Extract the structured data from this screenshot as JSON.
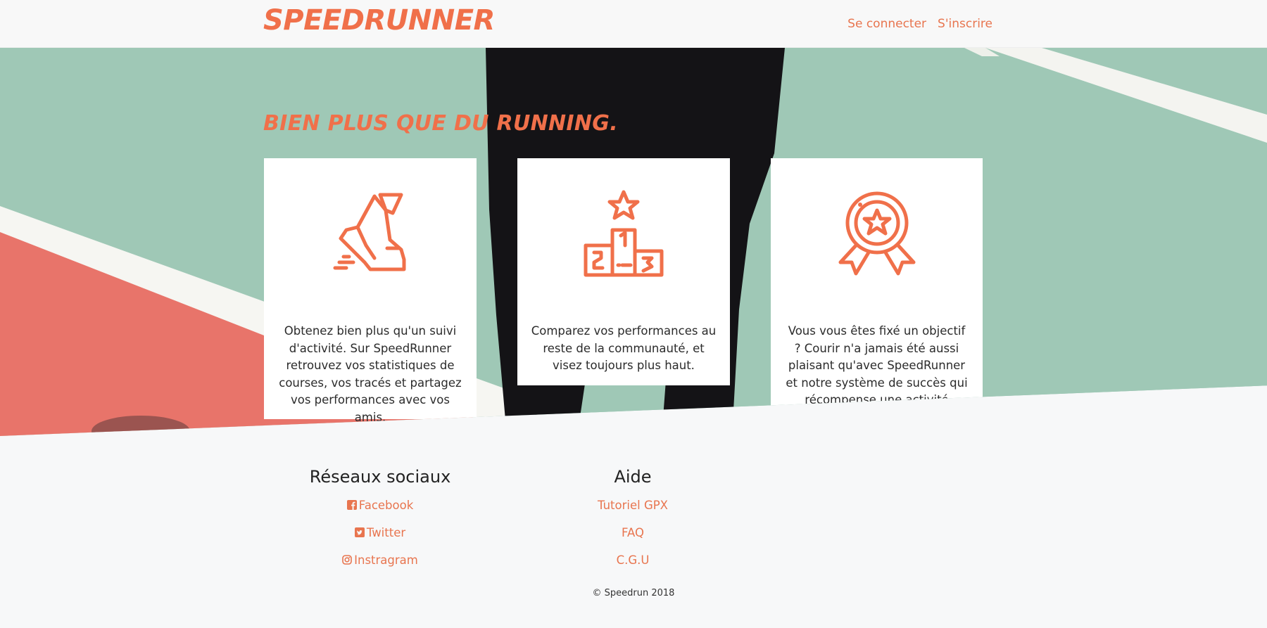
{
  "header": {
    "brand": "SPEEDRUNNER",
    "nav": {
      "login": "Se connecter",
      "signup": "S'inscrire"
    }
  },
  "hero": {
    "title": "BIEN PLUS QUE DU RUNNING.",
    "cards": [
      {
        "icon": "running-shoe-icon",
        "text": "Obtenez bien plus qu'un suivi d'activité. Sur SpeedRunner retrouvez vos statistiques de courses, vos tracés et partagez vos performances avec vos amis."
      },
      {
        "icon": "podium-icon",
        "text": "Comparez vos performances au reste de la communauté, et visez toujours plus haut."
      },
      {
        "icon": "medal-icon",
        "text": "Vous vous êtes fixé un objectif ? Courir n'a jamais été aussi plaisant qu'avec SpeedRunner et notre système de succès qui récompense une activité régulière."
      }
    ]
  },
  "footer": {
    "social": {
      "title": "Réseaux sociaux",
      "links": [
        {
          "label": "Facebook",
          "icon": "facebook-icon"
        },
        {
          "label": "Twitter",
          "icon": "twitter-icon"
        },
        {
          "label": "Instragram",
          "icon": "instagram-icon"
        }
      ]
    },
    "help": {
      "title": "Aide",
      "links": [
        {
          "label": "Tutoriel GPX"
        },
        {
          "label": "FAQ"
        },
        {
          "label": "C.G.U"
        }
      ]
    },
    "copyright": "© Speedrun 2018"
  },
  "colors": {
    "accent": "#f0704a",
    "track_green": "#9fc8b6",
    "track_red": "#e8746a"
  }
}
